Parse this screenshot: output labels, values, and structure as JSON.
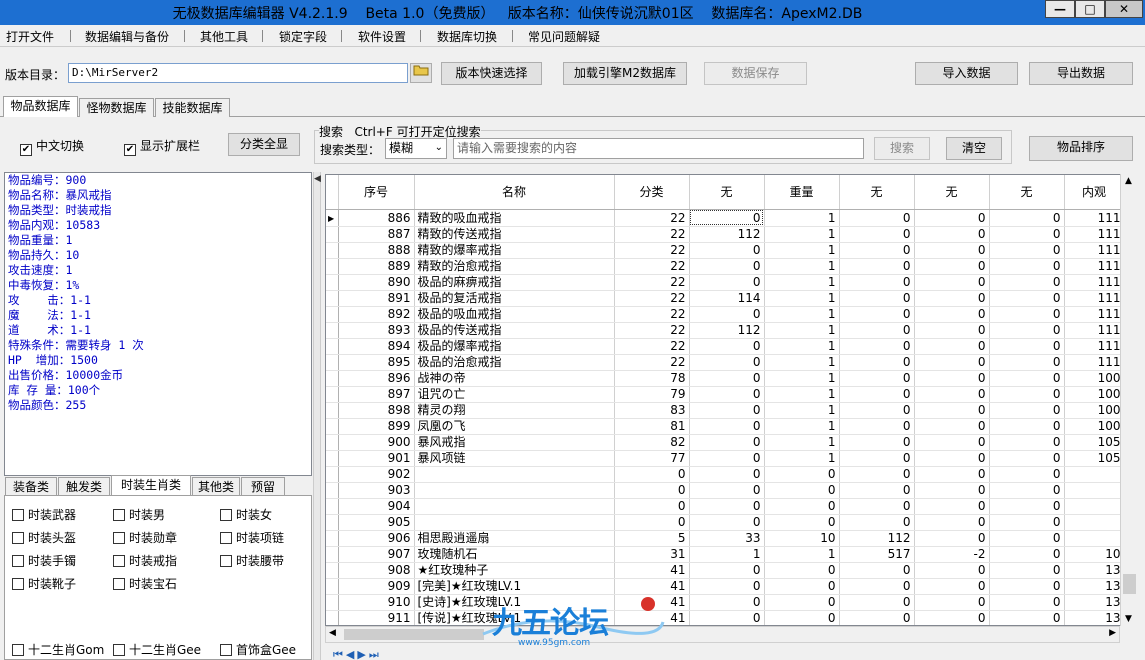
{
  "window": {
    "title": "无极数据库编辑器 V4.2.1.9    Beta 1.0（免费版）   版本名称：仙侠传说沉默01区    数据库名：ApexM2.DB",
    "minimize_glyph": "—",
    "maximize_glyph": "□",
    "close_glyph": "✕"
  },
  "menu": [
    "打开文件",
    "数据编辑与备份",
    "其他工具",
    "锁定字段",
    "软件设置",
    "数据库切换",
    "常见问题解疑"
  ],
  "toolbar": {
    "dir_label": "版本目录：",
    "dir_value": "D:\\MirServer2",
    "quick_select": "版本快速选择",
    "load_engine": "加载引擎M2数据库",
    "save_data": "数据保存",
    "import_data": "导入数据",
    "export_data": "导出数据"
  },
  "main_tabs": [
    "物品数据库",
    "怪物数据库",
    "技能数据库"
  ],
  "options": {
    "cn_switch": "中文切换",
    "show_ext": "显示扩展栏",
    "show_all": "分类全显",
    "search_title": "搜索   Ctrl+F 可打开定位搜索",
    "search_type_label": "搜索类型：",
    "search_type_value": "模糊",
    "search_placeholder": "请输入需要搜索的内容",
    "search_btn": "搜索",
    "clear_btn": "清空",
    "sort_btn": "物品排序"
  },
  "item_info": [
    "物品编号：900",
    "物品名称：暴风戒指",
    "物品类型：时装戒指",
    "物品内观：10583",
    "物品重量：1",
    "物品持久：10",
    "攻击速度：1",
    "中毒恢复：1%",
    "攻    击：1-1",
    "魔    法：1-1",
    "道    术：1-1",
    "特殊条件：需要转身 1 次",
    "HP  增加：1500",
    "出售价格：10000金币",
    "库 存 量：100个",
    "物品颜色：255"
  ],
  "sub_tabs": [
    "装备类",
    "触发类",
    "时装生肖类",
    "其他类",
    "预留"
  ],
  "sub_checks": [
    [
      "时装武器",
      "时装男",
      "时装女"
    ],
    [
      "时装头盔",
      "时装勋章",
      "时装项链"
    ],
    [
      "时装手镯",
      "时装戒指",
      "时装腰带"
    ],
    [
      "时装靴子",
      "时装宝石",
      ""
    ]
  ],
  "bottom_checks": [
    "十二生肖Gom",
    "十二生肖Gee",
    "首饰盒Gee"
  ],
  "grid": {
    "headers": [
      "序号",
      "名称",
      "分类",
      "无",
      "重量",
      "无",
      "无",
      "无",
      "内观"
    ],
    "rows": [
      [
        "886",
        "精致的吸血戒指",
        "22",
        "0",
        "1",
        "0",
        "0",
        "0",
        "111"
      ],
      [
        "887",
        "精致的传送戒指",
        "22",
        "112",
        "1",
        "0",
        "0",
        "0",
        "111"
      ],
      [
        "888",
        "精致的爆率戒指",
        "22",
        "0",
        "1",
        "0",
        "0",
        "0",
        "111"
      ],
      [
        "889",
        "精致的治愈戒指",
        "22",
        "0",
        "1",
        "0",
        "0",
        "0",
        "111"
      ],
      [
        "890",
        "极品的麻痹戒指",
        "22",
        "0",
        "1",
        "0",
        "0",
        "0",
        "111"
      ],
      [
        "891",
        "极品的复活戒指",
        "22",
        "114",
        "1",
        "0",
        "0",
        "0",
        "111"
      ],
      [
        "892",
        "极品的吸血戒指",
        "22",
        "0",
        "1",
        "0",
        "0",
        "0",
        "111"
      ],
      [
        "893",
        "极品的传送戒指",
        "22",
        "112",
        "1",
        "0",
        "0",
        "0",
        "111"
      ],
      [
        "894",
        "极品的爆率戒指",
        "22",
        "0",
        "1",
        "0",
        "0",
        "0",
        "111"
      ],
      [
        "895",
        "极品的治愈戒指",
        "22",
        "0",
        "1",
        "0",
        "0",
        "0",
        "111"
      ],
      [
        "896",
        "战神の帝",
        "78",
        "0",
        "1",
        "0",
        "0",
        "0",
        "100"
      ],
      [
        "897",
        "诅咒の亡",
        "79",
        "0",
        "1",
        "0",
        "0",
        "0",
        "100"
      ],
      [
        "898",
        "精灵の翔",
        "83",
        "0",
        "1",
        "0",
        "0",
        "0",
        "100"
      ],
      [
        "899",
        "凤凰の飞",
        "81",
        "0",
        "1",
        "0",
        "0",
        "0",
        "100"
      ],
      [
        "900",
        "暴风戒指",
        "82",
        "0",
        "1",
        "0",
        "0",
        "0",
        "105"
      ],
      [
        "901",
        "暴风项链",
        "77",
        "0",
        "1",
        "0",
        "0",
        "0",
        "105"
      ],
      [
        "902",
        "",
        "0",
        "0",
        "0",
        "0",
        "0",
        "0",
        ""
      ],
      [
        "903",
        "",
        "0",
        "0",
        "0",
        "0",
        "0",
        "0",
        ""
      ],
      [
        "904",
        "",
        "0",
        "0",
        "0",
        "0",
        "0",
        "0",
        ""
      ],
      [
        "905",
        "",
        "0",
        "0",
        "0",
        "0",
        "0",
        "0",
        ""
      ],
      [
        "906",
        "相思殿逍遥扇",
        "5",
        "33",
        "10",
        "112",
        "0",
        "0",
        ""
      ],
      [
        "907",
        "玫瑰随机石",
        "31",
        "1",
        "1",
        "517",
        "-2",
        "0",
        "10"
      ],
      [
        "908",
        "★红玫瑰种子",
        "41",
        "0",
        "0",
        "0",
        "0",
        "0",
        "13"
      ],
      [
        "909",
        "[完美]★红玫瑰LV.1",
        "41",
        "0",
        "0",
        "0",
        "0",
        "0",
        "13"
      ],
      [
        "910",
        "[史诗]★红玫瑰LV.1",
        "41",
        "0",
        "0",
        "0",
        "0",
        "0",
        "13"
      ],
      [
        "911",
        "[传说]★红玫瑰LV.1",
        "41",
        "0",
        "0",
        "0",
        "0",
        "0",
        "13"
      ]
    ]
  },
  "watermark": {
    "brand": "九五论坛",
    "url": "www.95gm.com"
  },
  "colors": {
    "titlebar": "#1d6fd1",
    "info_text": "#0000c8",
    "watermark": "#1a7fd8"
  }
}
